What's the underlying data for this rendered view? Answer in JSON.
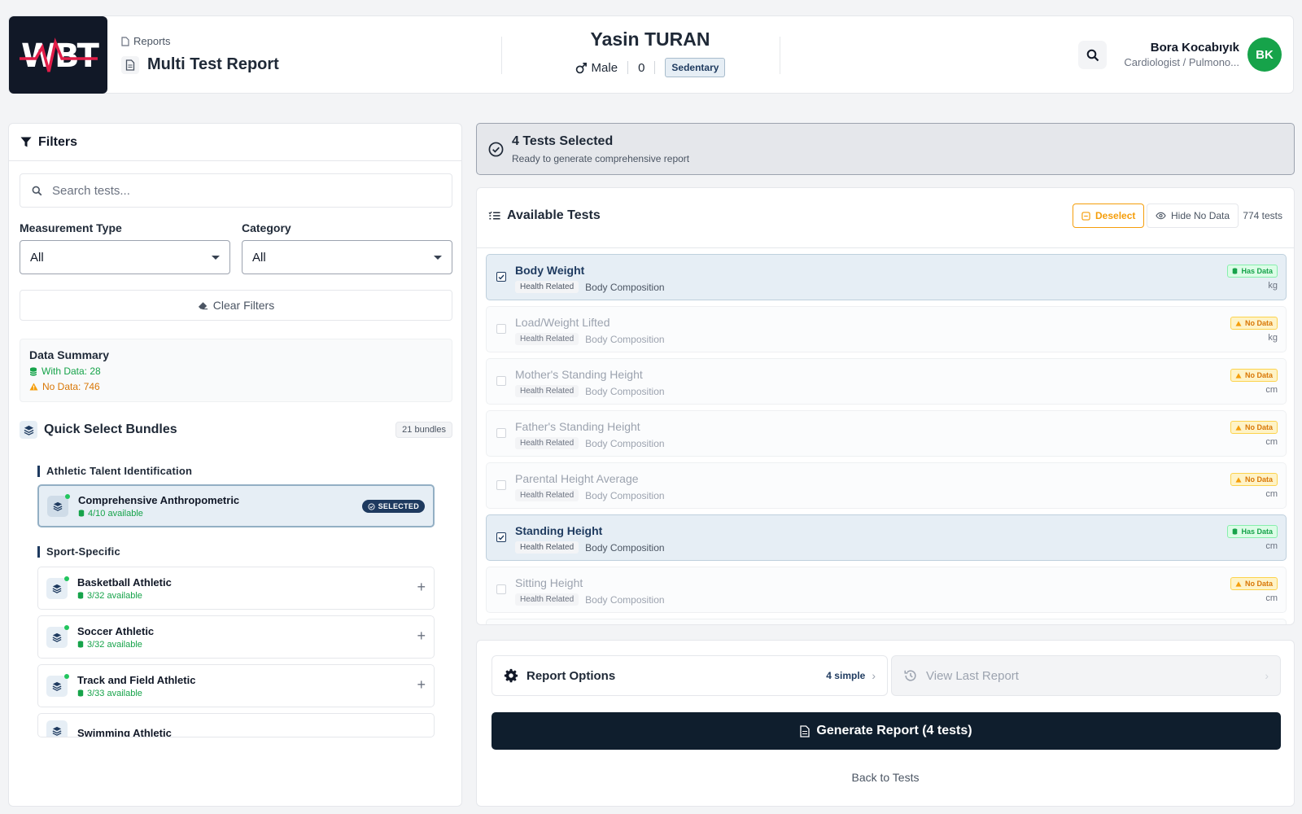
{
  "brand": {
    "logo_text": "WBT",
    "accent": "#1e3a5f",
    "success": "#16a34a",
    "warning": "#f59e0b"
  },
  "header": {
    "breadcrumb": "Reports",
    "title": "Multi Test Report",
    "patient": {
      "name": "Yasin TURAN",
      "gender": "Male",
      "age": "0",
      "activity": "Sedentary"
    },
    "user": {
      "name": "Bora Kocabıyık",
      "role": "Cardiologist / Pulmono...",
      "initials": "BK"
    }
  },
  "filters": {
    "title": "Filters",
    "search_placeholder": "Search tests...",
    "measurement_type": {
      "label": "Measurement Type",
      "value": "All"
    },
    "category": {
      "label": "Category",
      "value": "All"
    },
    "clear_label": "Clear Filters"
  },
  "summary": {
    "title": "Data Summary",
    "with_data": "With Data: 28",
    "no_data": "No Data: 746"
  },
  "bundles": {
    "title": "Quick Select Bundles",
    "count": "21 bundles",
    "groups": [
      {
        "title": "Athletic Talent Identification",
        "items": [
          {
            "name": "Comprehensive Anthropometric",
            "available": "4/10 available",
            "selected_label": "SELECTED"
          }
        ]
      },
      {
        "title": "Sport-Specific",
        "items": [
          {
            "name": "Basketball Athletic",
            "available": "3/32 available"
          },
          {
            "name": "Soccer Athletic",
            "available": "3/32 available"
          },
          {
            "name": "Track and Field Athletic",
            "available": "3/33 available"
          },
          {
            "name": "Swimming Athletic"
          }
        ]
      }
    ]
  },
  "selection": {
    "title": "4 Tests Selected",
    "subtitle": "Ready to generate comprehensive report"
  },
  "tests": {
    "title": "Available Tests",
    "deselect_label": "Deselect",
    "hide_label": "Hide No Data",
    "count": "774 tests",
    "rows": [
      {
        "name": "Body Weight",
        "tag": "Health Related",
        "category": "Body Composition",
        "status": "Has Data",
        "unit": "kg"
      },
      {
        "name": "Load/Weight Lifted",
        "tag": "Health Related",
        "category": "Body Composition",
        "status": "No Data",
        "unit": "kg"
      },
      {
        "name": "Mother's Standing Height",
        "tag": "Health Related",
        "category": "Body Composition",
        "status": "No Data",
        "unit": "cm"
      },
      {
        "name": "Father's Standing Height",
        "tag": "Health Related",
        "category": "Body Composition",
        "status": "No Data",
        "unit": "cm"
      },
      {
        "name": "Parental Height Average",
        "tag": "Health Related",
        "category": "Body Composition",
        "status": "No Data",
        "unit": "cm"
      },
      {
        "name": "Standing Height",
        "tag": "Health Related",
        "category": "Body Composition",
        "status": "Has Data",
        "unit": "cm"
      },
      {
        "name": "Sitting Height",
        "tag": "Health Related",
        "category": "Body Composition",
        "status": "No Data",
        "unit": "cm"
      }
    ]
  },
  "report": {
    "options_label": "Report Options",
    "options_value": "4 simple",
    "last_report_label": "View Last Report",
    "generate_label": "Generate Report (4 tests)",
    "back_label": "Back to Tests"
  }
}
